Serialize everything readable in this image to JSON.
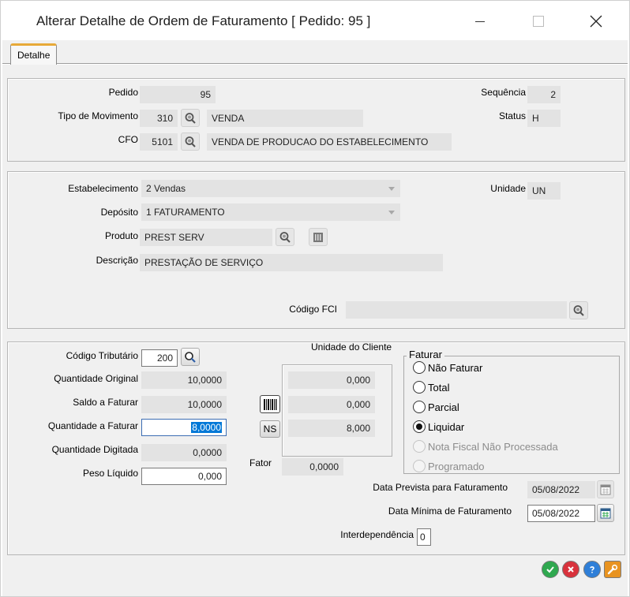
{
  "window": {
    "title": "Alterar Detalhe de Ordem de Faturamento [ Pedido: 95 ]"
  },
  "tabs": [
    {
      "label": "Detalhe"
    }
  ],
  "header": {
    "pedido_label": "Pedido",
    "pedido_value": "95",
    "sequencia_label": "Sequência",
    "sequencia_value": "2",
    "tipo_mov_label": "Tipo de Movimento",
    "tipo_mov_code": "310",
    "tipo_mov_desc": "VENDA",
    "status_label": "Status",
    "status_value": "H",
    "cfo_label": "CFO",
    "cfo_code": "5101",
    "cfo_desc": "VENDA DE PRODUCAO DO ESTABELECIMENTO"
  },
  "product": {
    "estab_label": "Estabelecimento",
    "estab_value": "2 Vendas",
    "unidade_label": "Unidade",
    "unidade_value": "UN",
    "deposito_label": "Depósito",
    "deposito_value": "1 FATURAMENTO",
    "produto_label": "Produto",
    "produto_value": "PREST SERV",
    "descricao_label": "Descrição",
    "descricao_value": "PRESTAÇÃO DE SERVIÇO",
    "fci_label": "Código FCI",
    "fci_value": ""
  },
  "quantities": {
    "cod_trib_label": "Código Tributário",
    "cod_trib_value": "200",
    "unidade_cliente_label": "Unidade do Cliente",
    "qtd_original_label": "Quantidade Original",
    "qtd_original_value": "10,0000",
    "saldo_label": "Saldo a Faturar",
    "saldo_value": "10,0000",
    "qtd_faturar_label": "Quantidade a Faturar",
    "qtd_faturar_value": "8,0000",
    "qtd_digitada_label": "Quantidade Digitada",
    "qtd_digitada_value": "0,0000",
    "peso_label": "Peso Líquido",
    "peso_value": "0,000",
    "cli_original": "0,000",
    "cli_saldo": "0,000",
    "cli_faturar": "8,000",
    "ns_label": "NS",
    "fator_label": "Fator",
    "fator_value": "0,0000"
  },
  "faturar": {
    "title": "Faturar",
    "options": [
      {
        "label": "Não Faturar",
        "checked": false,
        "disabled": false
      },
      {
        "label": "Total",
        "checked": false,
        "disabled": false
      },
      {
        "label": "Parcial",
        "checked": false,
        "disabled": false
      },
      {
        "label": "Liquidar",
        "checked": true,
        "disabled": false
      },
      {
        "label": "Nota Fiscal Não Processada",
        "checked": false,
        "disabled": true
      },
      {
        "label": "Programado",
        "checked": false,
        "disabled": true
      }
    ]
  },
  "dates": {
    "prevista_label": "Data Prevista para Faturamento",
    "prevista_value": "05/08/2022",
    "minima_label": "Data Mínima de Faturamento",
    "minima_value": "05/08/2022",
    "interdep_label": "Interdependência",
    "interdep_value": "0"
  },
  "colors": {
    "ok": "#2fa84f",
    "cancel": "#d8323c",
    "help": "#2f7fd8",
    "settings": "#e89320"
  }
}
